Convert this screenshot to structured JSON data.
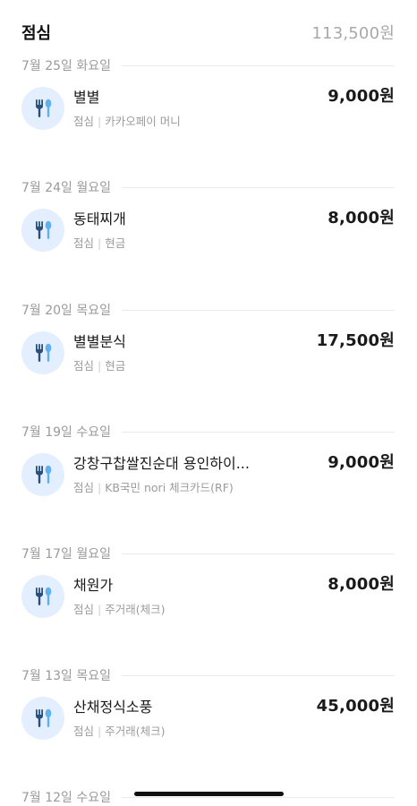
{
  "header": {
    "title": "점심",
    "total": "113,500원"
  },
  "groups": [
    {
      "date": "7월 25일 화요일",
      "name": "별별",
      "category": "점심",
      "method": "카카오페이 머니",
      "amount": "9,000원"
    },
    {
      "date": "7월 24일 월요일",
      "name": "동태찌개",
      "category": "점심",
      "method": "현금",
      "amount": "8,000원"
    },
    {
      "date": "7월 20일 목요일",
      "name": "별별분식",
      "category": "점심",
      "method": "현금",
      "amount": "17,500원"
    },
    {
      "date": "7월 19일 수요일",
      "name": "강창구찹쌀진순대 용인하이...",
      "category": "점심",
      "method": "KB국민 nori 체크카드(RF)",
      "amount": "9,000원"
    },
    {
      "date": "7월 17일 월요일",
      "name": "채원가",
      "category": "점심",
      "method": "주거래(체크)",
      "amount": "8,000원"
    },
    {
      "date": "7월 13일 목요일",
      "name": "산채정식소풍",
      "category": "점심",
      "method": "주거래(체크)",
      "amount": "45,000원"
    }
  ],
  "partial_group": {
    "date": "7월 12일 수요일"
  },
  "icons": {
    "transaction": "fork-spoon-icon"
  },
  "colors": {
    "icon_bg": "#e3efff",
    "fork": "#2a4f7a",
    "spoon": "#5fb0ee"
  }
}
